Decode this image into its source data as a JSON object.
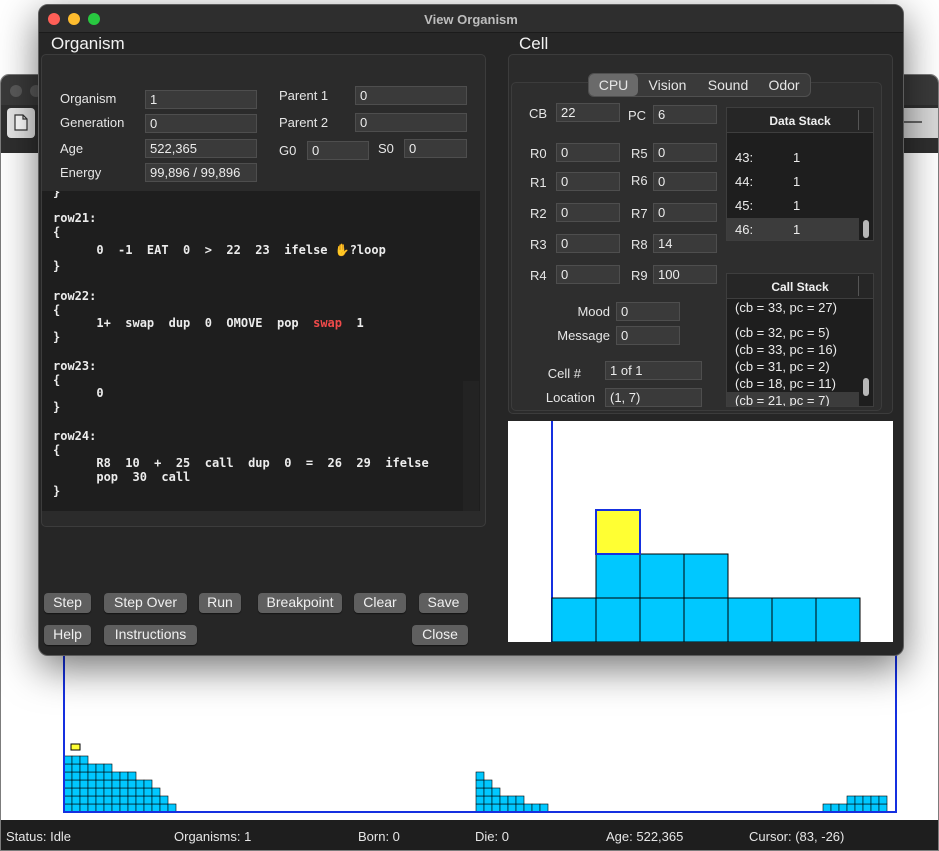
{
  "dialog": {
    "title": "View Organism",
    "organism_section": "Organism",
    "cell_section": "Cell"
  },
  "organism": {
    "labels": {
      "organism": "Organism",
      "generation": "Generation",
      "age": "Age",
      "energy": "Energy",
      "parent1": "Parent 1",
      "parent2": "Parent 2",
      "g0": "G0",
      "s0": "S0"
    },
    "values": {
      "organism": "1",
      "generation": "0",
      "age": "522,365",
      "energy": "99,896 / 99,896",
      "parent1": "0",
      "parent2": "0",
      "g0": "0",
      "s0": "0"
    }
  },
  "code": {
    "lines": [
      "}",
      "row21:",
      "{",
      "      0  -1  EAT  0  >  22  23  ifelse ✋?loop",
      "}",
      "",
      "row22:",
      "{",
      "      1+  swap  dup  0  OMOVE  pop  ",
      "}",
      "",
      "row23:",
      "{",
      "      0",
      "}",
      "",
      "row24:",
      "{",
      "      R8  10  +  25  call  dup  0  =  26  29  ifelse",
      "      pop  30  call",
      "}"
    ],
    "highlight_word": "swap",
    "after_highlight": "  1"
  },
  "tabs": [
    "CPU",
    "Vision",
    "Sound",
    "Odor"
  ],
  "selected_tab": "CPU",
  "cpu": {
    "cb_label": "CB",
    "cb": "22",
    "pc_label": "PC",
    "pc": "6",
    "registers": [
      {
        "name": "R0",
        "value": "0"
      },
      {
        "name": "R1",
        "value": "0"
      },
      {
        "name": "R2",
        "value": "0"
      },
      {
        "name": "R3",
        "value": "0"
      },
      {
        "name": "R4",
        "value": "0"
      },
      {
        "name": "R5",
        "value": "0"
      },
      {
        "name": "R6",
        "value": "0"
      },
      {
        "name": "R7",
        "value": "0"
      },
      {
        "name": "R8",
        "value": "14"
      },
      {
        "name": "R9",
        "value": "100"
      }
    ],
    "mood_label": "Mood",
    "mood": "0",
    "message_label": "Message",
    "message": "0",
    "cell_num_label": "Cell #",
    "cell_num": "1 of 1",
    "location_label": "Location",
    "location": "(1, 7)"
  },
  "data_stack": {
    "title": "Data Stack",
    "rows": [
      {
        "index": "43:",
        "value": "1"
      },
      {
        "index": "44:",
        "value": "1"
      },
      {
        "index": "45:",
        "value": "1"
      },
      {
        "index": "46:",
        "value": "1"
      }
    ],
    "selected": 3
  },
  "call_stack": {
    "title": "Call Stack",
    "rows": [
      "(cb = 33, pc = 27)",
      "(cb = 32, pc = 5)",
      "(cb = 33, pc = 16)",
      "(cb = 31, pc = 2)",
      "(cb = 18, pc = 11)",
      "(cb = 21, pc = 7)"
    ],
    "selected": 5
  },
  "buttons": {
    "step": "Step",
    "step_over": "Step Over",
    "run": "Run",
    "breakpoint": "Breakpoint",
    "clear": "Clear",
    "save": "Save",
    "help": "Help",
    "instructions": "Instructions",
    "close": "Close"
  },
  "colors": {
    "cell_fill": "#00c8ff",
    "cell_selected": "#ffff33",
    "world_border": "#1530e0"
  },
  "status": {
    "status": "Status: Idle",
    "organisms": "Organisms: 1",
    "born": "Born: 0",
    "die": "Die: 0",
    "age": "Age: 522,365",
    "cursor": "Cursor: (83, -26)"
  }
}
